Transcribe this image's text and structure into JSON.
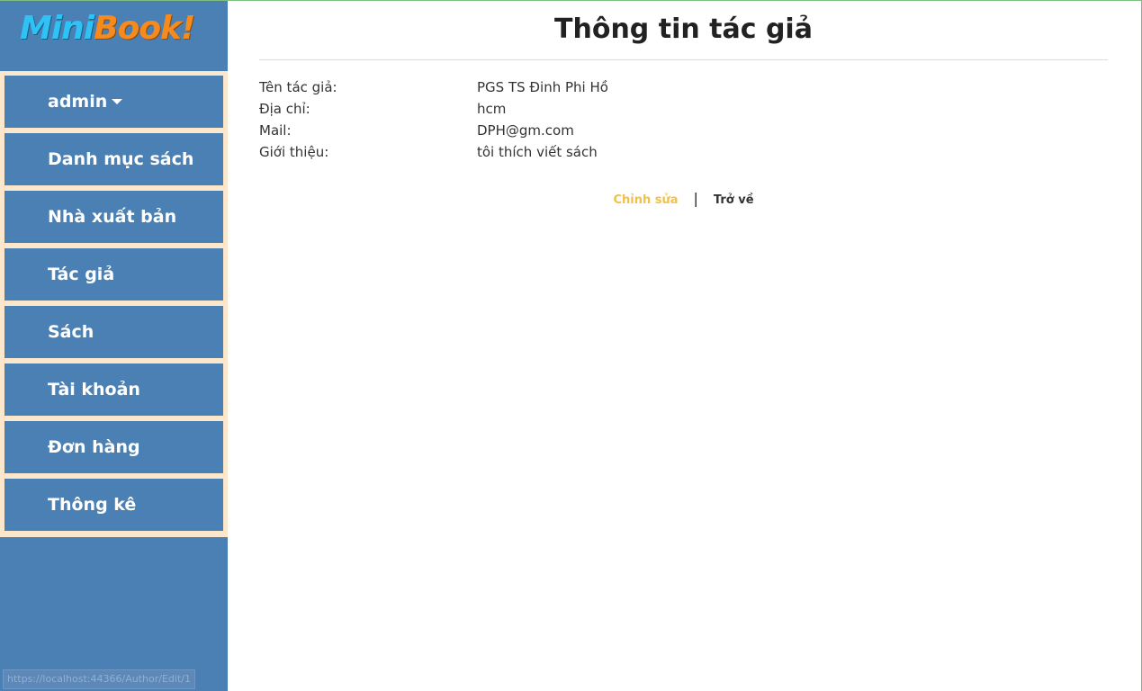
{
  "logo": {
    "part1": "Mini",
    "part2": "Book!"
  },
  "sidebar": {
    "items": [
      {
        "label": "admin",
        "has_caret": true
      },
      {
        "label": "Danh mục sách"
      },
      {
        "label": "Nhà xuất bản"
      },
      {
        "label": "Tác giả"
      },
      {
        "label": "Sách"
      },
      {
        "label": "Tài khoản"
      },
      {
        "label": "Đơn hàng"
      },
      {
        "label": "Thông kê"
      }
    ]
  },
  "status_bar": {
    "url": "https://localhost:44366/Author/Edit/1"
  },
  "main": {
    "title": "Thông tin tác giả",
    "fields": [
      {
        "label": "Tên tác giả:",
        "value": "PGS TS Đinh Phi Hồ"
      },
      {
        "label": "Địa chỉ:",
        "value": "hcm"
      },
      {
        "label": "Mail:",
        "value": "DPH@gm.com"
      },
      {
        "label": "Giới thiệu:",
        "value": "tôi thích viết sách"
      }
    ],
    "actions": {
      "edit_label": "Chỉnh sửa",
      "separator": "|",
      "back_label": "Trở về"
    }
  },
  "colors": {
    "sidebar": "#4a80b4",
    "menu_background": "#fbe8cc",
    "edit_link": "#f1c04a",
    "logo_mini": "#2ec2f5",
    "logo_book": "#f58a1f"
  }
}
